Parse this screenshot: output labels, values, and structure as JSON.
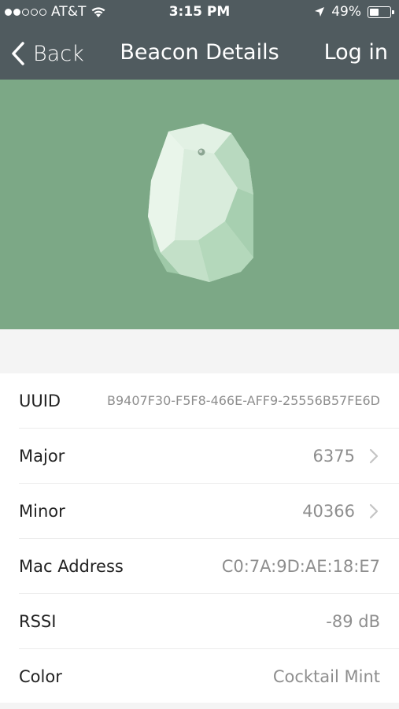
{
  "status_bar": {
    "carrier": "AT&T",
    "time": "3:15 PM",
    "battery": "49%",
    "battery_level": 0.49,
    "signal_bars_filled": 2,
    "signal_bars_total": 5
  },
  "nav": {
    "back_label": "Back",
    "title": "Beacon Details",
    "login_label": "Log in"
  },
  "hero": {
    "background_color": "#7ca886",
    "beacon_color": "Cocktail Mint"
  },
  "details": {
    "rows": [
      {
        "label": "UUID",
        "value": "B9407F30-F5F8-466E-AFF9-25556B57FE6D",
        "chevron": false
      },
      {
        "label": "Major",
        "value": "6375",
        "chevron": true
      },
      {
        "label": "Minor",
        "value": "40366",
        "chevron": true
      },
      {
        "label": "Mac Address",
        "value": "C0:7A:9D:AE:18:E7",
        "chevron": false
      },
      {
        "label": "RSSI",
        "value": "-89 dB",
        "chevron": false
      },
      {
        "label": "Color",
        "value": "Cocktail Mint",
        "chevron": false
      }
    ]
  },
  "colors": {
    "nav_bar": "#505b5f",
    "hero": "#7ca886",
    "value_text": "#8e8e8e"
  },
  "icons": {
    "back": "chevron-left-icon",
    "row_disclosure": "chevron-right-icon",
    "wifi": "wifi-icon",
    "location": "location-arrow-icon",
    "battery": "battery-icon"
  }
}
